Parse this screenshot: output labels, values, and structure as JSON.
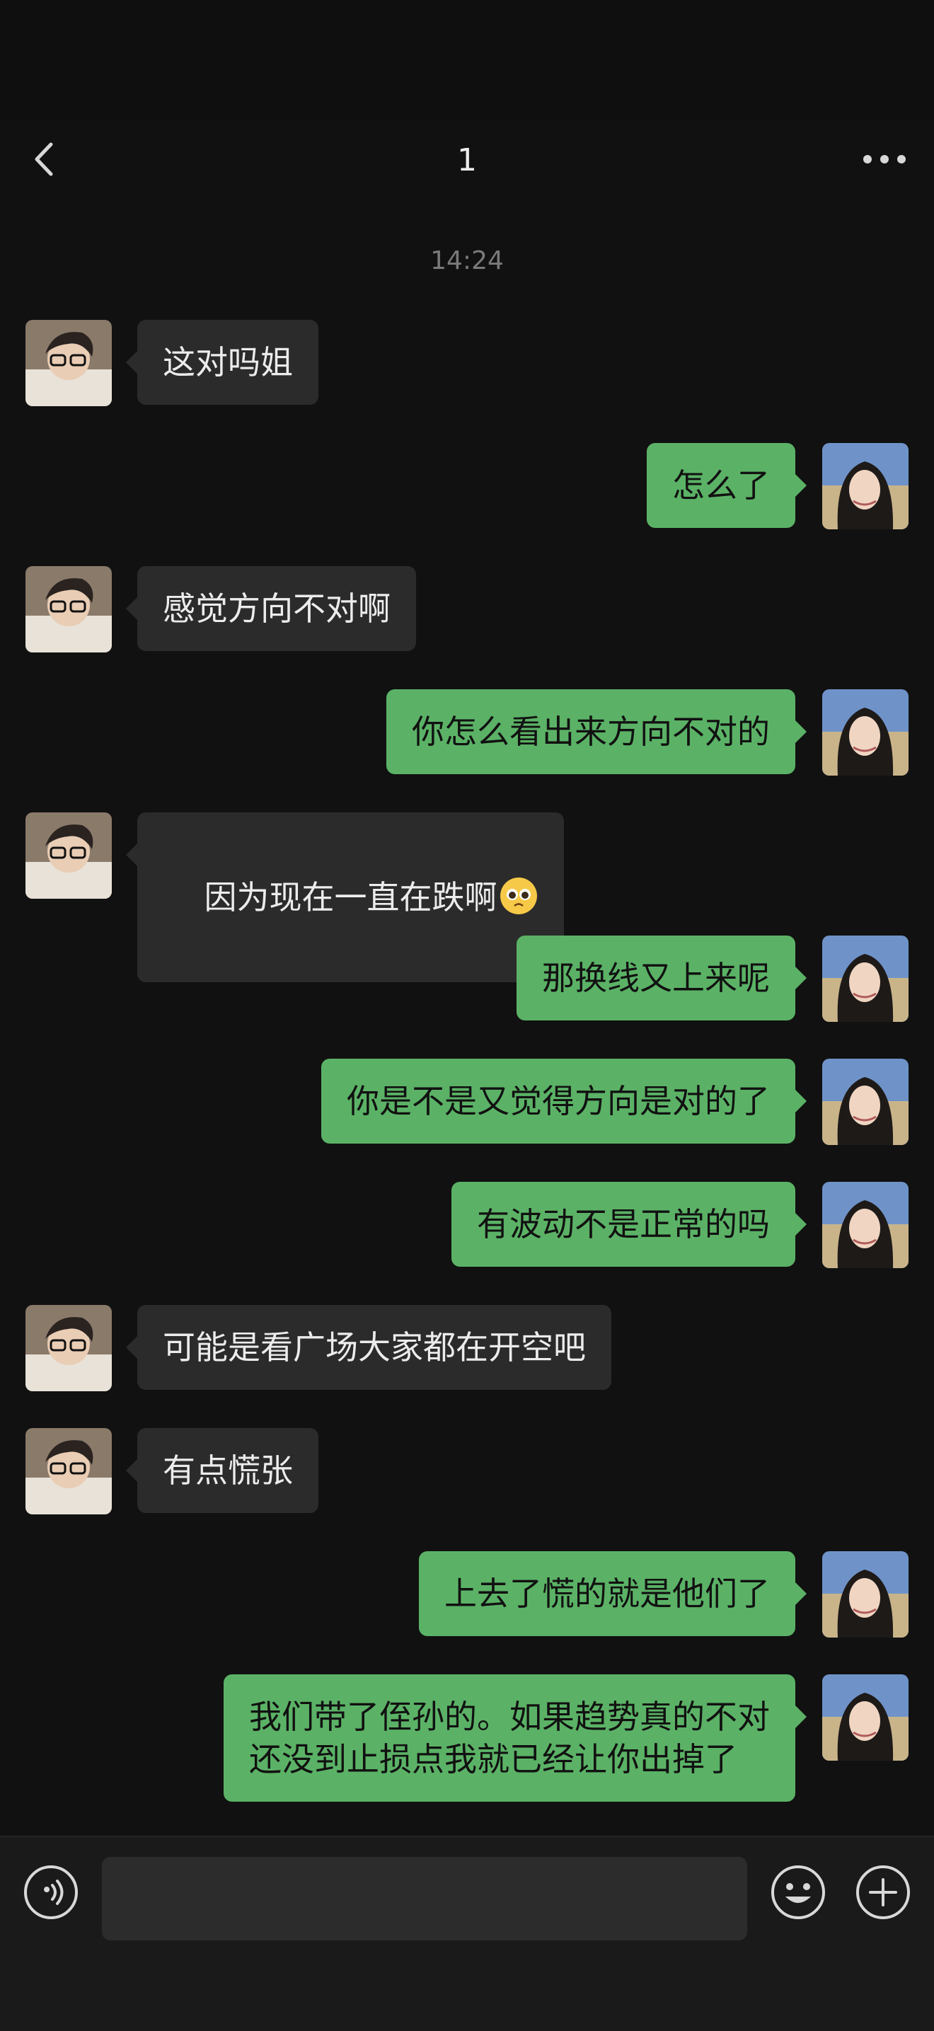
{
  "header": {
    "title": "1"
  },
  "chat": {
    "timestamp": "14:24",
    "messages": [
      {
        "side": "left",
        "text": "这对吗姐"
      },
      {
        "side": "right",
        "text": "怎么了"
      },
      {
        "side": "left",
        "text": "感觉方向不对啊"
      },
      {
        "side": "right",
        "text": "你怎么看出来方向不对的"
      },
      {
        "side": "left",
        "text": "因为现在一直在跌啊",
        "emoji": "pleading-face"
      },
      {
        "side": "right",
        "text": "那换线又上来呢"
      },
      {
        "side": "right",
        "text": "你是不是又觉得方向是对的了"
      },
      {
        "side": "right",
        "text": "有波动不是正常的吗"
      },
      {
        "side": "left",
        "text": "可能是看广场大家都在开空吧"
      },
      {
        "side": "left",
        "text": "有点慌张"
      },
      {
        "side": "right",
        "text": "上去了慌的就是他们了"
      },
      {
        "side": "right",
        "text": "我们带了侄孙的。如果趋势真的不对\n还没到止损点我就已经让你出掉了"
      }
    ]
  },
  "input_bar": {
    "placeholder": "",
    "icons": [
      "voice-icon",
      "emoji-icon",
      "plus-icon"
    ]
  },
  "colors": {
    "background": "#111111",
    "bubble_sent": "#5bb266",
    "bubble_received": "#2b2b2b"
  }
}
